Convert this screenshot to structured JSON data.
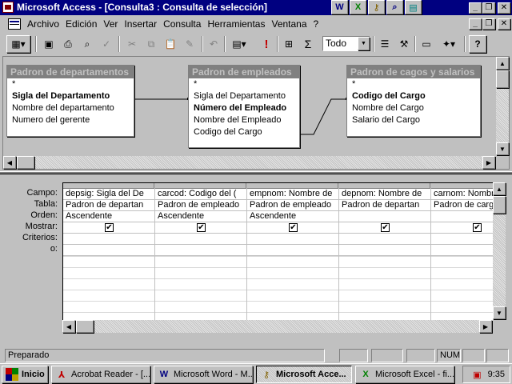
{
  "window": {
    "title": "Microsoft Access - [Consulta3 : Consulta de selección]",
    "controls": {
      "minimize": "_",
      "restore": "❐",
      "close": "✕"
    }
  },
  "office_shortcuts": [
    {
      "icon": "word-icon",
      "glyph": "W"
    },
    {
      "icon": "excel-icon",
      "glyph": "X"
    },
    {
      "icon": "key-icon",
      "glyph": "⚷"
    },
    {
      "icon": "find-icon",
      "glyph": "⌕"
    },
    {
      "icon": "network-icon",
      "glyph": "▤"
    }
  ],
  "menu": {
    "items": [
      {
        "label": "Archivo"
      },
      {
        "label": "Edición"
      },
      {
        "label": "Ver"
      },
      {
        "label": "Insertar"
      },
      {
        "label": "Consulta"
      },
      {
        "label": "Herramientas"
      },
      {
        "label": "Ventana"
      },
      {
        "label": "?"
      }
    ]
  },
  "toolbar": {
    "buttons": [
      {
        "icon": "view-icon",
        "glyph": "▦"
      },
      {
        "icon": "save-icon",
        "glyph": "▣"
      },
      {
        "icon": "print-icon",
        "glyph": "⎙"
      },
      {
        "icon": "print-preview-icon",
        "glyph": "⌕"
      },
      {
        "icon": "spelling-icon",
        "glyph": "✓"
      },
      {
        "icon": "cut-icon",
        "glyph": "✂"
      },
      {
        "icon": "copy-icon",
        "glyph": "⧉"
      },
      {
        "icon": "paste-icon",
        "glyph": "📋"
      },
      {
        "icon": "format-painter-icon",
        "glyph": "✎"
      },
      {
        "icon": "undo-icon",
        "glyph": "↶"
      },
      {
        "icon": "query-type-icon",
        "glyph": "▤"
      },
      {
        "icon": "run-icon",
        "glyph": "!"
      },
      {
        "icon": "show-table-icon",
        "glyph": "⊞"
      },
      {
        "icon": "totals-icon",
        "glyph": "Σ"
      },
      {
        "icon": "properties-icon",
        "glyph": "☰"
      },
      {
        "icon": "build-icon",
        "glyph": "⚒"
      },
      {
        "icon": "database-window-icon",
        "glyph": "▭"
      },
      {
        "icon": "new-object-icon",
        "glyph": "✦"
      },
      {
        "icon": "help-icon",
        "glyph": "?"
      }
    ],
    "top_values": "Todo"
  },
  "tables": [
    {
      "name": "Padron de departamentos",
      "fields": [
        {
          "name": "*",
          "key": false
        },
        {
          "name": "Sigla del Departamento",
          "key": true
        },
        {
          "name": "Nombre del departamento",
          "key": false
        },
        {
          "name": "Numero del gerente",
          "key": false
        }
      ]
    },
    {
      "name": "Padron de empleados",
      "fields": [
        {
          "name": "*",
          "key": false
        },
        {
          "name": "Sigla del Departamento",
          "key": false
        },
        {
          "name": "Número del Empleado",
          "key": true
        },
        {
          "name": "Nombre del Empleado",
          "key": false
        },
        {
          "name": "Codigo del Cargo",
          "key": false
        }
      ]
    },
    {
      "name": "Padron de cagos y salarios",
      "fields": [
        {
          "name": "*",
          "key": false
        },
        {
          "name": "Codigo del Cargo",
          "key": true
        },
        {
          "name": "Nombre del Cargo",
          "key": false
        },
        {
          "name": "Salario del Cargo",
          "key": false
        }
      ]
    }
  ],
  "grid": {
    "row_labels": [
      "Campo:",
      "Tabla:",
      "Orden:",
      "Mostrar:",
      "Criterios:",
      "o:"
    ],
    "columns": [
      {
        "field": "depsig: Sigla del De",
        "table": "Padron de departan",
        "sort": "Ascendente",
        "show": true
      },
      {
        "field": "carcod: Codigo del (",
        "table": "Padron de empleado",
        "sort": "Ascendente",
        "show": true
      },
      {
        "field": "empnom: Nombre de",
        "table": "Padron de empleado",
        "sort": "Ascendente",
        "show": true
      },
      {
        "field": "depnom: Nombre de",
        "table": "Padron de departan",
        "sort": "",
        "show": true
      },
      {
        "field": "carnom: Nombre",
        "table": "Padron de cargo",
        "sort": "",
        "show": true
      }
    ],
    "checkmark": "✔"
  },
  "status": {
    "text": "Preparado",
    "num": "NUM"
  },
  "taskbar": {
    "start": "Inicio",
    "tasks": [
      {
        "label": "Acrobat Reader - [...",
        "icon": "acrobat-icon",
        "glyph": "⅄",
        "active": false
      },
      {
        "label": "Microsoft Word - M...",
        "icon": "word-icon",
        "glyph": "W",
        "active": false
      },
      {
        "label": "Microsoft Acce...",
        "icon": "access-key-icon",
        "glyph": "⚷",
        "active": true
      },
      {
        "label": "Microsoft Excel - fi...",
        "icon": "excel-icon",
        "glyph": "X",
        "active": false
      }
    ],
    "clock": "9:35"
  }
}
